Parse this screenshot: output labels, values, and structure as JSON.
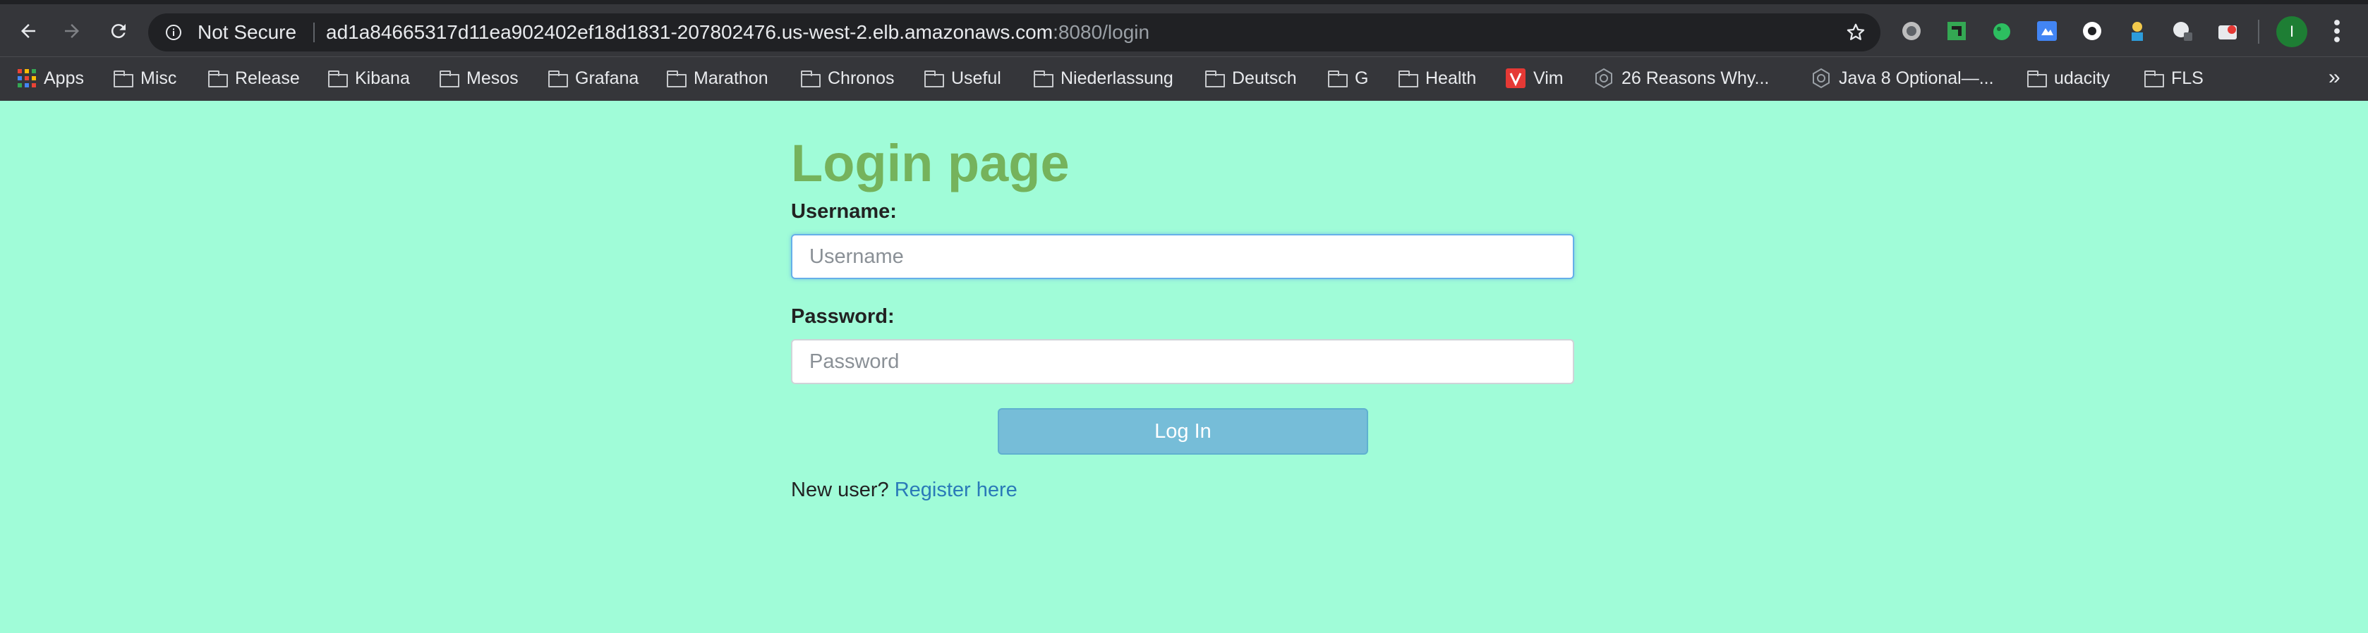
{
  "browser": {
    "security_label": "Not Secure",
    "url_host": "ad1a84665317d11ea902402ef18d1831-207802476.us-west-2.elb.amazonaws.com",
    "url_path": ":8080/login",
    "profile_initial": "I",
    "bookmarks": [
      {
        "label": "Apps",
        "icon": "apps-grid-icon"
      },
      {
        "label": "Misc",
        "icon": "folder-icon"
      },
      {
        "label": "Release",
        "icon": "folder-icon"
      },
      {
        "label": "Kibana",
        "icon": "folder-icon"
      },
      {
        "label": "Mesos",
        "icon": "folder-icon"
      },
      {
        "label": "Grafana",
        "icon": "folder-icon"
      },
      {
        "label": "Marathon",
        "icon": "folder-icon"
      },
      {
        "label": "Chronos",
        "icon": "folder-icon"
      },
      {
        "label": "Useful",
        "icon": "folder-icon"
      },
      {
        "label": "Niederlassung",
        "icon": "folder-icon"
      },
      {
        "label": "Deutsch",
        "icon": "folder-icon"
      },
      {
        "label": "G",
        "icon": "folder-icon"
      },
      {
        "label": "Health",
        "icon": "folder-icon"
      },
      {
        "label": "Vim",
        "icon": "vim-icon"
      },
      {
        "label": "26 Reasons Why...",
        "icon": "hex-icon"
      },
      {
        "label": "Java 8 Optional—...",
        "icon": "hex-icon"
      },
      {
        "label": "udacity",
        "icon": "folder-icon"
      },
      {
        "label": "FLS",
        "icon": "folder-icon"
      }
    ],
    "overflow_label": "»"
  },
  "page": {
    "title": "Login page",
    "username_label": "Username:",
    "username_placeholder": "Username",
    "password_label": "Password:",
    "password_placeholder": "Password",
    "login_button": "Log In",
    "new_user_text": "New user?",
    "register_link": "Register here"
  },
  "colors": {
    "page_background": "#a0fcd8",
    "title": "#75b35c",
    "button": "#76bdd8",
    "link": "#2a7ab8",
    "chrome": "#35363a"
  }
}
